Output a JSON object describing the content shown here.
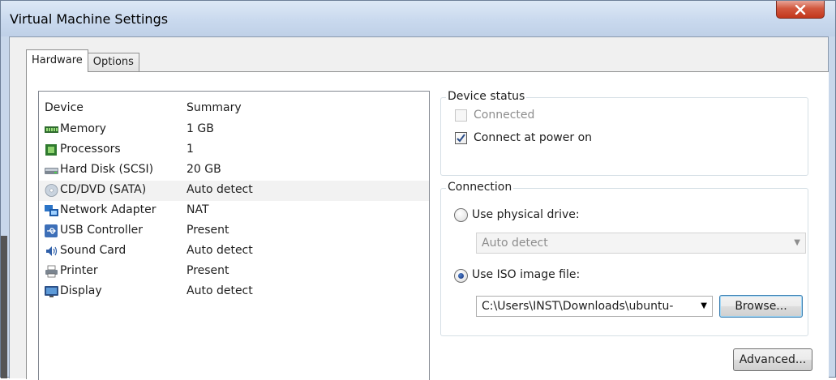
{
  "window": {
    "title": "Virtual Machine Settings",
    "close_glyph": "X"
  },
  "tabs": [
    {
      "label": "Hardware",
      "active": true
    },
    {
      "label": "Options",
      "active": false
    }
  ],
  "device_list": {
    "columns": {
      "device": "Device",
      "summary": "Summary"
    },
    "rows": [
      {
        "device": "Memory",
        "summary": "1 GB",
        "icon": "memory-icon"
      },
      {
        "device": "Processors",
        "summary": "1",
        "icon": "processor-icon"
      },
      {
        "device": "Hard Disk (SCSI)",
        "summary": "20 GB",
        "icon": "hard-disk-icon"
      },
      {
        "device": "CD/DVD (SATA)",
        "summary": "Auto detect",
        "icon": "cd-dvd-icon",
        "selected": true
      },
      {
        "device": "Network Adapter",
        "summary": "NAT",
        "icon": "network-adapter-icon"
      },
      {
        "device": "USB Controller",
        "summary": "Present",
        "icon": "usb-icon"
      },
      {
        "device": "Sound Card",
        "summary": "Auto detect",
        "icon": "sound-card-icon"
      },
      {
        "device": "Printer",
        "summary": "Present",
        "icon": "printer-icon"
      },
      {
        "device": "Display",
        "summary": "Auto detect",
        "icon": "display-icon"
      }
    ]
  },
  "device_status": {
    "label": "Device status",
    "connected": {
      "label": "Connected",
      "checked": false,
      "disabled": true
    },
    "connect_at_power_on": {
      "label": "Connect at power on",
      "checked": true
    }
  },
  "connection": {
    "label": "Connection",
    "physical_drive": {
      "label": "Use physical drive:",
      "selected": false
    },
    "physical_drive_select": {
      "value": "Auto detect",
      "disabled": true
    },
    "iso_image": {
      "label": "Use ISO image file:",
      "selected": true
    },
    "iso_path": {
      "value": "C:\\Users\\INST\\Downloads\\ubuntu-"
    },
    "browse_label": "Browse..."
  },
  "advanced_label": "Advanced...",
  "colors": {
    "selection": "#f2f2f2",
    "close_button": "#c2371c",
    "radio_dot": "#15307a"
  }
}
